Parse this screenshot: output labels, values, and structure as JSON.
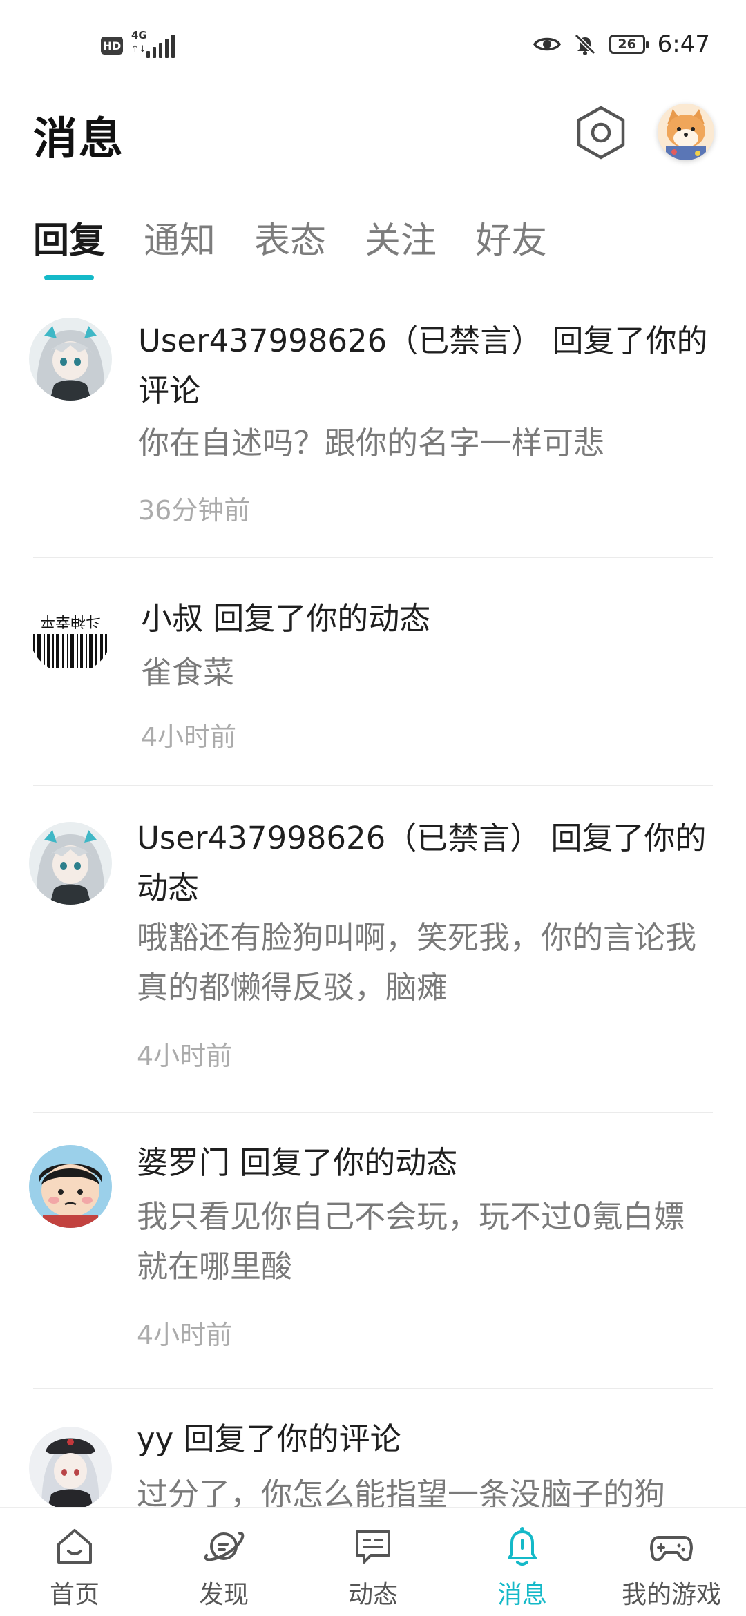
{
  "status_bar": {
    "hd": "HD",
    "network": "4G",
    "network_arrows": "↑↓",
    "battery": "26",
    "time": "6:47",
    "icons": [
      "signal-icon",
      "eye-icon",
      "bell-off-icon",
      "battery-icon"
    ]
  },
  "header": {
    "title": "消息",
    "settings_icon": "hexagon-settings-icon",
    "avatar_icon": "shiba-avatar"
  },
  "tabs": [
    {
      "label": "回复",
      "active": true
    },
    {
      "label": "通知",
      "active": false
    },
    {
      "label": "表态",
      "active": false
    },
    {
      "label": "关注",
      "active": false
    },
    {
      "label": "好友",
      "active": false
    }
  ],
  "accent_color": "#14b9c8",
  "messages": [
    {
      "title": "User437998626（已禁言） 回复了你的评论",
      "body": "你在自述吗？跟你的名字一样可悲",
      "time": "36分钟前",
      "avatar": "anime-girl-avatar"
    },
    {
      "title": "小叔 回复了你的动态",
      "body": "雀食菜",
      "time": "4小时前",
      "avatar": "barcode-avatar"
    },
    {
      "title": "User437998626（已禁言） 回复了你的动态",
      "body": "哦豁还有脸狗叫啊，笑死我，你的言论我真的都懒得反驳，脑瘫",
      "time": "4小时前",
      "avatar": "anime-girl-avatar"
    },
    {
      "title": "婆罗门 回复了你的动态",
      "body": "我只看见你自己不会玩，玩不过0氪白嫖就在哪里酸",
      "time": "4小时前",
      "avatar": "cartoon-boy-avatar"
    },
    {
      "title": "yy 回复了你的评论",
      "body": "过分了，你怎么能指望一条没脑子的狗",
      "time": "",
      "avatar": "anime-hat-girl-avatar"
    }
  ],
  "bottom_nav": [
    {
      "label": "首页",
      "icon": "home-icon",
      "active": false
    },
    {
      "label": "发现",
      "icon": "planet-icon",
      "active": false
    },
    {
      "label": "动态",
      "icon": "chat-card-icon",
      "active": false
    },
    {
      "label": "消息",
      "icon": "bell-icon",
      "active": true
    },
    {
      "label": "我的游戏",
      "icon": "gamepad-icon",
      "active": false
    }
  ]
}
